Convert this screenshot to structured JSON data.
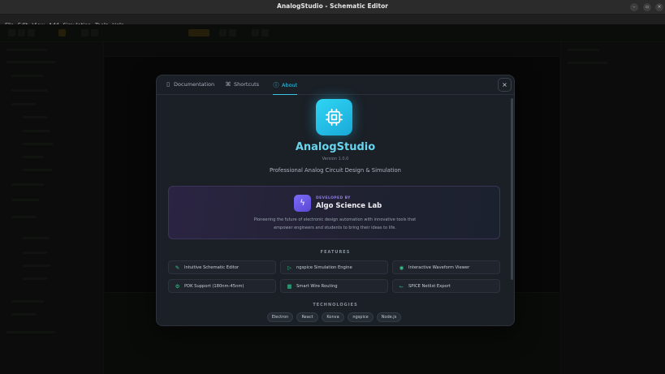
{
  "window": {
    "title": "AnalogStudio - Schematic Editor",
    "controls": [
      "minimize-icon",
      "maximize-icon",
      "close-icon"
    ]
  },
  "menubar": {
    "items": [
      "File",
      "Edit",
      "View",
      "Add",
      "Simulation",
      "Tools",
      "Help"
    ]
  },
  "modal": {
    "tabs": [
      {
        "label": "Documentation",
        "icon": "book-icon"
      },
      {
        "label": "Shortcuts",
        "icon": "command-icon"
      },
      {
        "label": "About",
        "icon": "info-icon",
        "active": true
      }
    ],
    "close_icon": "close-icon",
    "app": {
      "name": "AnalogStudio",
      "version": "Version 1.0.0",
      "tagline": "Professional Analog Circuit Design & Simulation",
      "icon": "chip-icon"
    },
    "developer": {
      "label": "DEVELOPED BY",
      "name": "Algo Science Lab",
      "icon": "lightning-icon",
      "description_line1": "Pioneering the future of electronic design automation with innovative tools that",
      "description_line2": "empower engineers and students to bring their ideas to life."
    },
    "features_title": "FEATURES",
    "features": [
      {
        "label": "Intuitive Schematic Editor",
        "icon": "pencil-icon"
      },
      {
        "label": "ngspice Simulation Engine",
        "icon": "play-icon"
      },
      {
        "label": "Interactive Waveform Viewer",
        "icon": "eye-icon"
      },
      {
        "label": "PDK Support (180nm-45nm)",
        "icon": "chip-small-icon"
      },
      {
        "label": "Smart Wire Routing",
        "icon": "grid-icon"
      },
      {
        "label": "SPICE Netlist Export",
        "icon": "netlist-icon"
      }
    ],
    "technologies_title": "TECHNOLOGIES",
    "technologies": [
      "Electron",
      "React",
      "Konva",
      "ngspice",
      "Node.js"
    ]
  },
  "colors": {
    "accent": "#36c6e6",
    "feature_icon": "#33c48a",
    "developer_accent": "#8f7cf0",
    "modal_bg": "#1b1f26"
  }
}
